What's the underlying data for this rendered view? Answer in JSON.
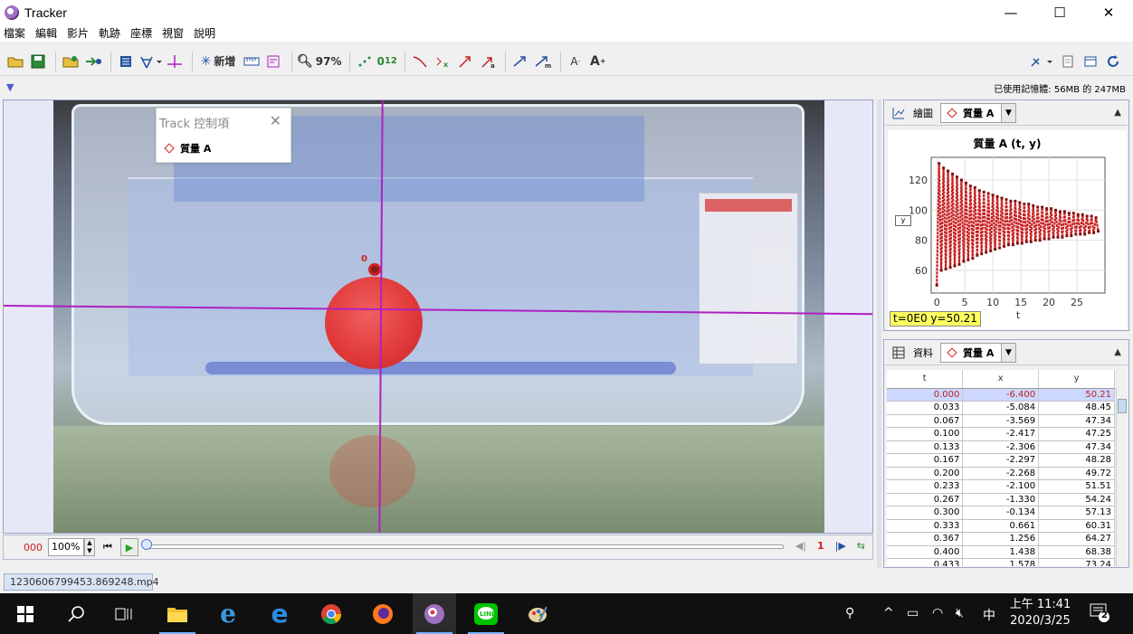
{
  "window": {
    "title": "Tracker",
    "min_glyph": "—",
    "max_glyph": "☐",
    "close_glyph": "✕"
  },
  "menu": [
    "檔案",
    "編輯",
    "影片",
    "軌跡",
    "座標",
    "視窗",
    "說明"
  ],
  "toolbar": {
    "new_track_label": "新增",
    "zoom_label": "97%",
    "ovo_label": "0",
    "ovo_sub": "12"
  },
  "memory": {
    "text": "已使用記憶體: 56MB 的 247MB"
  },
  "track_control": {
    "title": "Track 控制項",
    "item": "質量 A"
  },
  "video": {
    "marker_label": "0"
  },
  "player": {
    "frame": "000",
    "zoom": "100%",
    "step_value": "1"
  },
  "file_tab": "1230606799453.869248.mp4",
  "plot_panel": {
    "header_label": "繪圖",
    "track": "質量 A",
    "title": "質量 A (t, y)",
    "readout": "t=0E0  y=50.21",
    "y_button": "y"
  },
  "chart_data": {
    "type": "line",
    "title": "質量 A (t, y)",
    "xlabel": "t",
    "ylabel": "y",
    "xlim": [
      -1,
      30
    ],
    "ylim": [
      45,
      135
    ],
    "xticks": [
      0,
      5,
      10,
      15,
      20,
      25
    ],
    "yticks": [
      60,
      80,
      100,
      120
    ],
    "grid": true,
    "color": "#c81e1e",
    "series": [
      {
        "x": [
          0,
          0.4,
          0.8,
          1.2,
          1.6,
          2.0,
          2.4,
          2.8,
          3.2,
          3.6,
          4.0,
          4.4,
          4.8,
          5.2,
          5.6,
          6.0,
          6.4,
          6.8,
          7.2,
          7.6,
          8.0,
          8.4,
          8.8,
          9.2,
          9.6,
          10.0,
          10.4,
          10.8,
          11.2,
          11.6,
          12.0,
          12.4,
          12.8,
          13.2,
          13.6,
          14.0,
          14.4,
          14.8,
          15.2,
          15.6,
          16.0,
          16.4,
          16.8,
          17.2,
          17.6,
          18.0,
          18.4,
          18.8,
          19.2,
          19.6,
          20.0,
          20.4,
          20.8,
          21.2,
          21.6,
          22.0,
          22.4,
          22.8,
          23.2,
          23.6,
          24.0,
          24.4,
          24.8,
          25.2,
          25.6,
          26.0,
          26.4,
          26.8,
          27.2,
          27.6,
          28.0,
          28.4,
          28.8
        ],
        "y": [
          50.21,
          131,
          60,
          128,
          61,
          126,
          62,
          124,
          63,
          122,
          64,
          120,
          66,
          118,
          67,
          116,
          68,
          115,
          70,
          113,
          71,
          112,
          72,
          111,
          73,
          110,
          74,
          109,
          75,
          108,
          76,
          107,
          77,
          106,
          77,
          106,
          78,
          105,
          78,
          104,
          79,
          104,
          79,
          103,
          80,
          102,
          80,
          102,
          81,
          101,
          81,
          101,
          82,
          100,
          82,
          99,
          82,
          99,
          83,
          98,
          83,
          98,
          84,
          97,
          84,
          97,
          84,
          96,
          85,
          96,
          85,
          95,
          86
        ]
      }
    ]
  },
  "data_panel": {
    "header_label": "資料",
    "track": "質量 A",
    "columns": [
      "t",
      "x",
      "y"
    ],
    "rows": [
      [
        "0.000",
        "-6.400",
        "50.21"
      ],
      [
        "0.033",
        "-5.084",
        "48.45"
      ],
      [
        "0.067",
        "-3.569",
        "47.34"
      ],
      [
        "0.100",
        "-2.417",
        "47.25"
      ],
      [
        "0.133",
        "-2.306",
        "47.34"
      ],
      [
        "0.167",
        "-2.297",
        "48.28"
      ],
      [
        "0.200",
        "-2.268",
        "49.72"
      ],
      [
        "0.233",
        "-2.100",
        "51.51"
      ],
      [
        "0.267",
        "-1.330",
        "54.24"
      ],
      [
        "0.300",
        "-0.134",
        "57.13"
      ],
      [
        "0.333",
        "0.661",
        "60.31"
      ],
      [
        "0.367",
        "1.256",
        "64.27"
      ],
      [
        "0.400",
        "1.438",
        "68.38"
      ],
      [
        "0.433",
        "1.578",
        "73.24"
      ]
    ]
  },
  "taskbar": {
    "clock_time": "上午 11:41",
    "clock_date": "2020/3/25",
    "ime": "中",
    "notification_count": "2"
  }
}
